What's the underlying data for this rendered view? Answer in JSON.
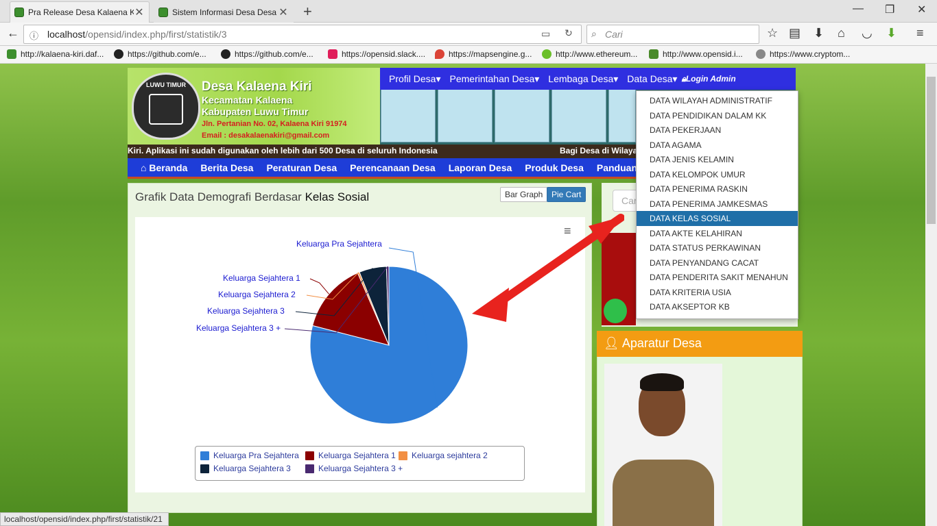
{
  "browser": {
    "tabs": [
      {
        "title": "Pra Release Desa Kalaena Kiri",
        "active": true
      },
      {
        "title": "Sistem Informasi Desa Desa Le",
        "active": false
      }
    ],
    "url_host": "localhost",
    "url_path": "/opensid/index.php/first/statistik/3",
    "search_placeholder": "Cari",
    "bookmarks": [
      {
        "label": "http://kalaena-kiri.daf...",
        "icon": "village-icon"
      },
      {
        "label": "https://github.com/e...",
        "icon": "github-icon"
      },
      {
        "label": "https://github.com/e...",
        "icon": "github-icon"
      },
      {
        "label": "https://opensid.slack....",
        "icon": "slack-icon"
      },
      {
        "label": "https://mapsengine.g...",
        "icon": "map-pin-icon"
      },
      {
        "label": "http://www.ethereum...",
        "icon": "ethereum-icon"
      },
      {
        "label": "http://www.opensid.i...",
        "icon": "opensid-icon"
      },
      {
        "label": "https://www.cryptom...",
        "icon": "globe-icon"
      }
    ],
    "status_url": "localhost/opensid/index.php/first/statistik/21"
  },
  "header": {
    "logo_text": "LUWU TIMUR",
    "site_name": "Desa Kalaena Kiri",
    "kecamatan": "Kecamatan Kalaena",
    "kabupaten": "Kabupaten Luwu Timur",
    "address": "Jln. Pertanian No. 02, Kalaena Kiri 91974",
    "email": "Email : desakalaenakiri@gmail.com",
    "marquee_left": "Kiri. Aplikasi ini sudah digunakan oleh lebih dari 500 Desa di seluruh Indonesia",
    "marquee_right": "Bagi Desa di Wilayah"
  },
  "topnav": {
    "items": [
      "Profil Desa",
      "Pemerintahan Desa",
      "Lembaga Desa",
      "Data Desa"
    ],
    "login": "Login Admin"
  },
  "mainnav": {
    "items": [
      "Beranda",
      "Berita Desa",
      "Peraturan Desa",
      "Perencanaan Desa",
      "Laporan Desa",
      "Produk Desa",
      "Panduan La"
    ]
  },
  "content": {
    "title_prefix": "Grafik Data Demografi Berdasar",
    "title_subject": "Kelas Sosial",
    "bar_button": "Bar Graph",
    "pie_button": "Pie Cart"
  },
  "chart_data": {
    "type": "pie",
    "title": "",
    "slices": [
      {
        "label": "Keluarga Pra Sejahtera",
        "value": 79.0,
        "color": "#2f7ed8"
      },
      {
        "label": "Keluarga Sejahtera 1",
        "value": 14.5,
        "color": "#8b0000"
      },
      {
        "label": "Keluarga Sejahtera  2",
        "value": 0.4,
        "color": "#f28f43"
      },
      {
        "label": "Keluarga Sejahtera  3",
        "value": 5.6,
        "color": "#0d233a"
      },
      {
        "label": "Keluarga Sejahtera  3 +",
        "value": 0.5,
        "color": "#492970"
      }
    ],
    "pie_labels": [
      "Keluarga Pra Sejahtera",
      "Keluarga Sejahtera 1",
      "Keluarga Sejahtera  2",
      "Keluarga Sejahtera  3",
      "Keluarga Sejahtera  3 +"
    ],
    "legend": [
      {
        "label": "Keluarga Pra Sejahtera",
        "color": "#2f7ed8"
      },
      {
        "label": "Keluarga Sejahtera 1",
        "color": "#8b0000"
      },
      {
        "label": "Keluarga sejahtera 2",
        "color": "#f28f43"
      },
      {
        "label": "Keluarga Sejahtera 3",
        "color": "#0d233a"
      },
      {
        "label": "Keluarga Sejahtera 3 +",
        "color": "#492970"
      }
    ],
    "legend_placement": "bottom"
  },
  "sidebar": {
    "search_placeholder": "Cari",
    "aparatur_title": "Aparatur Desa"
  },
  "dropdown": {
    "items": [
      "DATA WILAYAH ADMINISTRATIF",
      "DATA PENDIDIKAN DALAM KK",
      "DATA PEKERJAAN",
      "DATA AGAMA",
      "DATA JENIS KELAMIN",
      "DATA KELOMPOK UMUR",
      "DATA PENERIMA RASKIN",
      "DATA PENERIMA JAMKESMAS",
      "DATA KELAS SOSIAL",
      "DATA AKTE KELAHIRAN",
      "DATA STATUS PERKAWINAN",
      "DATA PENYANDANG CACAT",
      "DATA PENDERITA SAKIT MENAHUN",
      "DATA KRITERIA USIA",
      "DATA AKSEPTOR KB"
    ],
    "active_index": 8
  },
  "colors": {
    "accent_arrow": "#e8231e",
    "nav_blue": "#2f2fe0",
    "orange": "#f39c12"
  }
}
